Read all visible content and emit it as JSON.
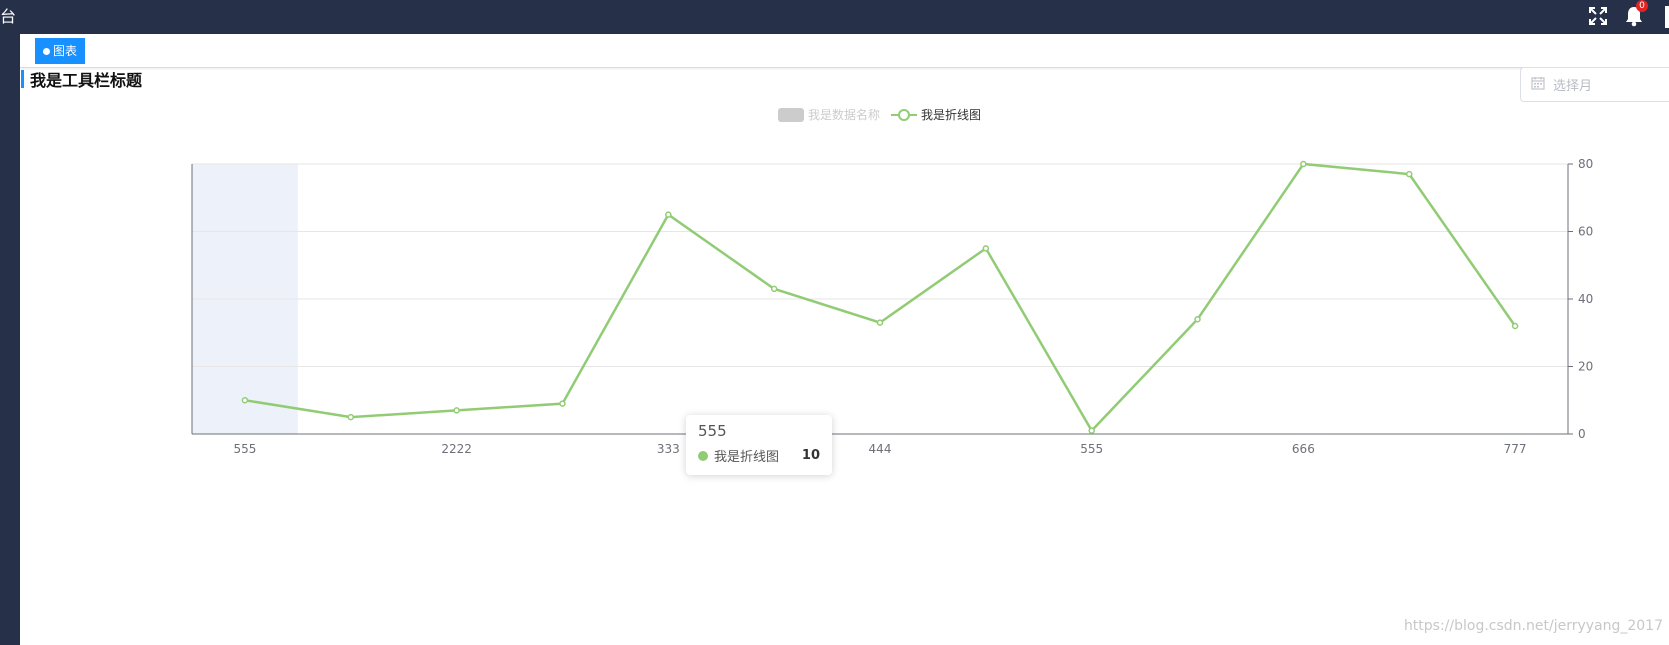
{
  "app": {
    "top_left_char": "台",
    "notification_count": "0"
  },
  "tab": {
    "label": "图表"
  },
  "toolbar": {
    "title": "我是工具栏标题"
  },
  "month_picker": {
    "placeholder": "选择月"
  },
  "colors": {
    "topbar": "#263049",
    "accent": "#1890ff",
    "line": "#91cc75",
    "highlight_band": "#edf1f9",
    "badge": "#e52222"
  },
  "chart_data": {
    "type": "line",
    "legend": [
      {
        "name": "我是数据名称",
        "visible": false
      },
      {
        "name": "我是折线图",
        "visible": true
      }
    ],
    "categories": [
      "555",
      "",
      "2222",
      "",
      "333",
      "",
      "444",
      "",
      "555",
      "",
      "666",
      "",
      "777"
    ],
    "series": [
      {
        "name": "我是折线图",
        "values": [
          10,
          5,
          7,
          9,
          65,
          43,
          33,
          55,
          1,
          34,
          80,
          77,
          32
        ]
      }
    ],
    "yaxis_position": "right",
    "ylim": [
      0,
      80
    ],
    "yticks": [
      0,
      20,
      40,
      60,
      80
    ],
    "grid": true,
    "legend_position": "top-center",
    "highlighted_index": 0
  },
  "tooltip": {
    "title": "555",
    "series_name": "我是折线图",
    "value": "10"
  },
  "watermark": "https://blog.csdn.net/jerryyang_2017"
}
